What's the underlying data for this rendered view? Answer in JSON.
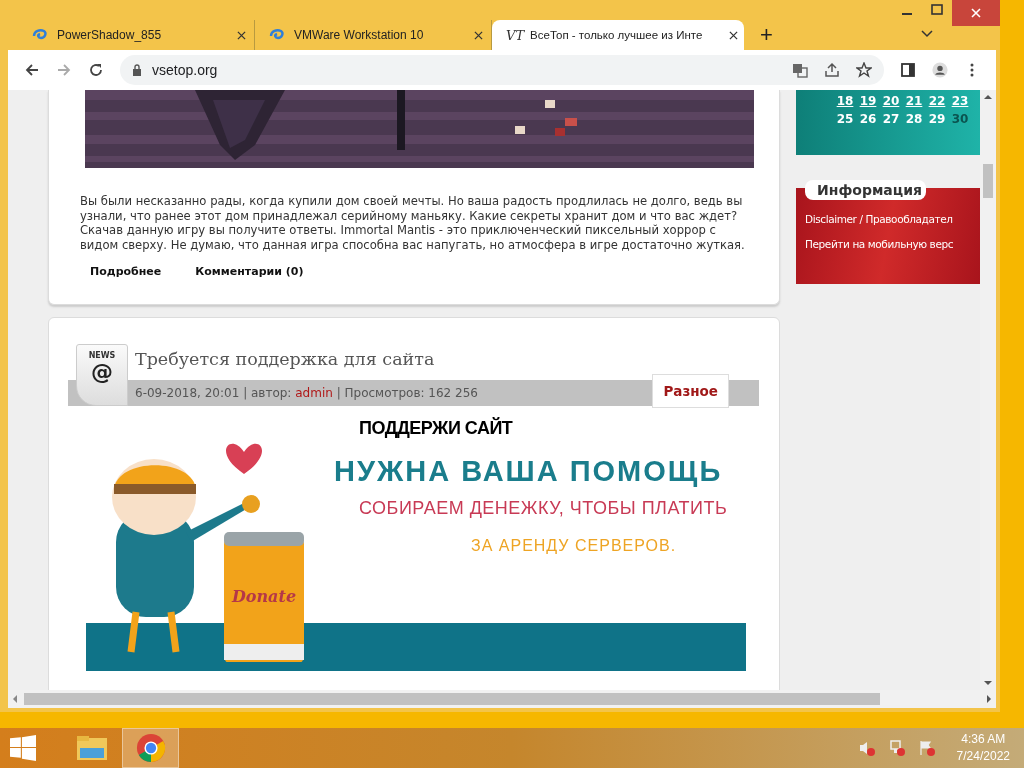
{
  "tabs": [
    {
      "title": "PowerShadow_855",
      "selected": false
    },
    {
      "title": "VMWare Workstation 10",
      "selected": false
    },
    {
      "title": "ВсеТоп - только лучшее из Инте",
      "logo": "VT",
      "selected": true
    }
  ],
  "new_tab": "+",
  "address": {
    "url": "vsetop.org"
  },
  "posts": [
    {
      "kind": "continued",
      "picture": {
        "kind": "picture"
      },
      "text": "Вы были несказанно рады, когда купили дом своей мечты. Но ваша радость продлилась не долго, ведь вы узнали, что ранее этот дом принадлежал серийному маньяку. Какие секреты хранит дом и что вас ждет? Скачав данную игру вы получите ответы. Immortal Mantis - это приключенческий пиксельный хоррор с видом сверху. Не думаю, что данная игра способна вас напугать, но атмосфера в игре достаточно жуткая.",
      "links": [
        "Подробнее",
        "Комментарии (0)"
      ]
    },
    {
      "kind": "news",
      "badge": "NEWS",
      "badge_symbol": "@",
      "title": "Требуется поддержка для сайта",
      "meta": [
        {
          "text": "6-09-2018, 20:01 | автор: ",
          "link": false
        },
        {
          "text": "admin",
          "link": true
        },
        {
          "text": " | Просмотров: 162 256",
          "link": false
        }
      ],
      "category": "Разное",
      "banner": {
        "lines": [
          "ПОДДЕРЖИ САЙТ",
          "НУЖНА ВАША ПОМОЩЬ",
          "СОБИРАЕМ ДЕНЕЖКУ, ЧТОБЫ ПЛАТИТЬ",
          "ЗА АРЕНДУ СЕРВЕРОВ."
        ],
        "can_label": "Donate"
      }
    }
  ],
  "sidebar": {
    "calendar": [
      [
        {
          "day": "18",
          "linked": true,
          "dimmed": false
        },
        {
          "day": "19",
          "linked": true,
          "dimmed": false
        },
        {
          "day": "20",
          "linked": true,
          "dimmed": false
        },
        {
          "day": "21",
          "linked": true,
          "dimmed": false
        },
        {
          "day": "22",
          "linked": true,
          "dimmed": false
        },
        {
          "day": "23",
          "linked": true,
          "dimmed": false
        }
      ],
      [
        {
          "day": "25",
          "linked": false,
          "dimmed": false
        },
        {
          "day": "26",
          "linked": false,
          "dimmed": false
        },
        {
          "day": "27",
          "linked": false,
          "dimmed": false
        },
        {
          "day": "28",
          "linked": false,
          "dimmed": false
        },
        {
          "day": "29",
          "linked": false,
          "dimmed": false
        },
        {
          "day": "30",
          "linked": false,
          "dimmed": true
        }
      ]
    ],
    "info": {
      "title": "Информация",
      "links": [
        "Disclaimer / Правообладател",
        "Перейти на мобильную верс"
      ]
    }
  },
  "taskbar": {
    "time": "4:36 AM",
    "date": "7/24/2022"
  }
}
